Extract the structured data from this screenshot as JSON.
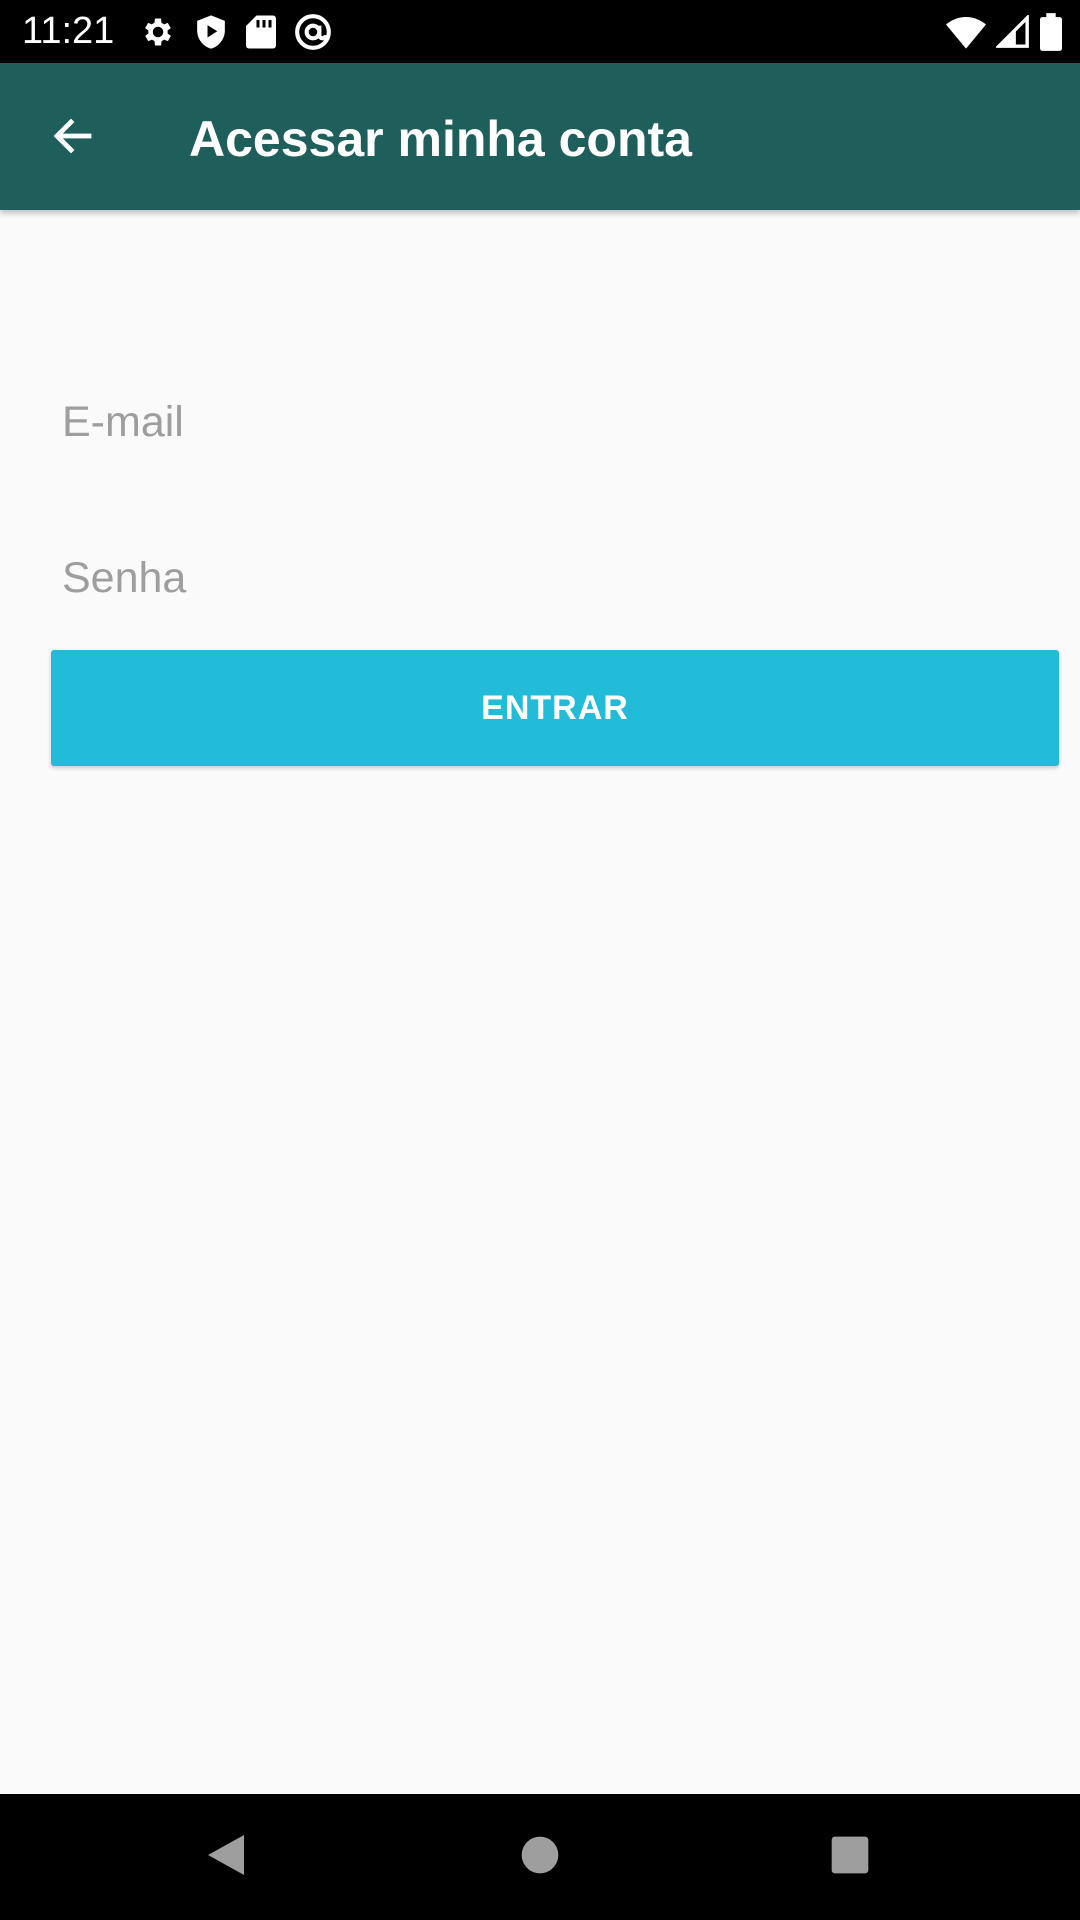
{
  "status_bar": {
    "time": "11:21",
    "left_icons": [
      "settings-icon",
      "shield-play-icon",
      "sd-card-icon",
      "at-sign-icon"
    ],
    "right_icons": [
      "wifi-icon",
      "cell-signal-icon",
      "battery-icon"
    ]
  },
  "app_bar": {
    "back_icon": "arrow-back-icon",
    "title": "Acessar minha conta",
    "background_color": "#1f5f5b"
  },
  "form": {
    "email": {
      "value": "",
      "placeholder": "E-mail"
    },
    "password": {
      "value": "",
      "placeholder": "Senha"
    },
    "submit_label": "ENTRAR",
    "submit_color": "#22bbd8"
  },
  "nav_bar": {
    "items": [
      "nav-back-icon",
      "nav-home-icon",
      "nav-recents-icon"
    ]
  }
}
